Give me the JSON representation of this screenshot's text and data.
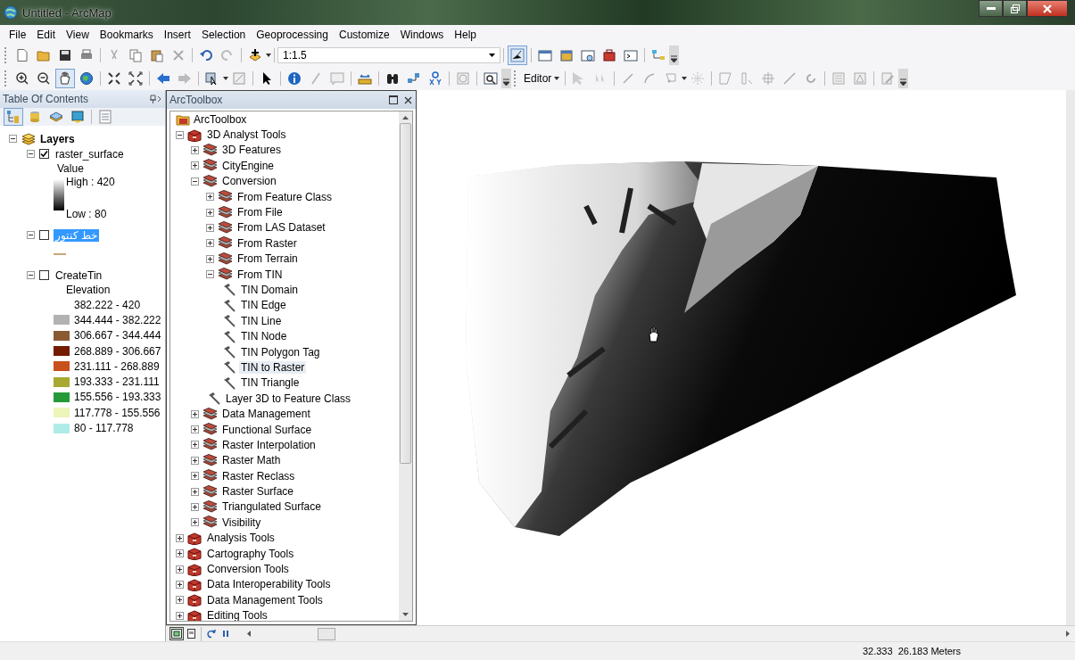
{
  "window": {
    "title": "Untitled - ArcMap"
  },
  "menu": [
    "File",
    "Edit",
    "View",
    "Bookmarks",
    "Insert",
    "Selection",
    "Geoprocessing",
    "Customize",
    "Windows",
    "Help"
  ],
  "standard_toolbar": {
    "scale": "1:1.5"
  },
  "tools_toolbar": {
    "editor_menu": "Editor"
  },
  "table_of_contents": {
    "title": "Table Of Contents",
    "root": {
      "label": "Layers",
      "expanded": true
    },
    "layers": [
      {
        "name": "raster_surface",
        "kind": "stretch",
        "expanded": true,
        "checked": true,
        "selected": false,
        "field": "Value",
        "high": "High : 420",
        "low": "Low : 80"
      },
      {
        "name": "خط کنتور",
        "kind": "line",
        "expanded": true,
        "checked": false,
        "selected": true
      },
      {
        "name": "CreateTin",
        "kind": "classes",
        "expanded": true,
        "checked": false,
        "selected": false,
        "field": "Elevation",
        "classes": [
          {
            "label": "382.222 - 420"
          },
          {
            "label": "344.444 - 382.222",
            "color": "#b2b2b2"
          },
          {
            "label": "306.667 - 344.444",
            "color": "#8a5a32"
          },
          {
            "label": "268.889 - 306.667",
            "color": "#731c00"
          },
          {
            "label": "231.111 - 268.889",
            "color": "#c8501a"
          },
          {
            "label": "193.333 - 231.111",
            "color": "#a8a832"
          },
          {
            "label": "155.556 - 193.333",
            "color": "#269a38"
          },
          {
            "label": "117.778 - 155.556",
            "color": "#eef5b8"
          },
          {
            "label": "80 - 117.778",
            "color": "#b0ece6"
          }
        ]
      }
    ]
  },
  "arctoolbox": {
    "title": "ArcToolbox",
    "root": "ArcToolbox",
    "items": [
      {
        "label": "3D Analyst Tools",
        "kind": "toolbox",
        "expanded": true,
        "children": [
          {
            "label": "3D Features",
            "kind": "toolset",
            "expanded": false
          },
          {
            "label": "CityEngine",
            "kind": "toolset",
            "expanded": false
          },
          {
            "label": "Conversion",
            "kind": "toolset",
            "expanded": true,
            "children": [
              {
                "label": "From Feature Class",
                "kind": "toolset",
                "expanded": false
              },
              {
                "label": "From File",
                "kind": "toolset",
                "expanded": false
              },
              {
                "label": "From LAS Dataset",
                "kind": "toolset",
                "expanded": false
              },
              {
                "label": "From Raster",
                "kind": "toolset",
                "expanded": false
              },
              {
                "label": "From Terrain",
                "kind": "toolset",
                "expanded": false
              },
              {
                "label": "From TIN",
                "kind": "toolset",
                "expanded": true,
                "children": [
                  {
                    "label": "TIN Domain",
                    "kind": "tool",
                    "selected": false
                  },
                  {
                    "label": "TIN Edge",
                    "kind": "tool",
                    "selected": false
                  },
                  {
                    "label": "TIN Line",
                    "kind": "tool",
                    "selected": false
                  },
                  {
                    "label": "TIN Node",
                    "kind": "tool",
                    "selected": false
                  },
                  {
                    "label": "TIN Polygon Tag",
                    "kind": "tool",
                    "selected": false
                  },
                  {
                    "label": "TIN to Raster",
                    "kind": "tool",
                    "selected": true
                  },
                  {
                    "label": "TIN Triangle",
                    "kind": "tool",
                    "selected": false
                  }
                ]
              },
              {
                "label": "Layer 3D to Feature Class",
                "kind": "tool",
                "selected": false
              }
            ]
          },
          {
            "label": "Data Management",
            "kind": "toolset",
            "expanded": false
          },
          {
            "label": "Functional Surface",
            "kind": "toolset",
            "expanded": false
          },
          {
            "label": "Raster Interpolation",
            "kind": "toolset",
            "expanded": false
          },
          {
            "label": "Raster Math",
            "kind": "toolset",
            "expanded": false
          },
          {
            "label": "Raster Reclass",
            "kind": "toolset",
            "expanded": false
          },
          {
            "label": "Raster Surface",
            "kind": "toolset",
            "expanded": false
          },
          {
            "label": "Triangulated Surface",
            "kind": "toolset",
            "expanded": false
          },
          {
            "label": "Visibility",
            "kind": "toolset",
            "expanded": false
          }
        ]
      },
      {
        "label": "Analysis Tools",
        "kind": "toolbox",
        "expanded": false
      },
      {
        "label": "Cartography Tools",
        "kind": "toolbox",
        "expanded": false
      },
      {
        "label": "Conversion Tools",
        "kind": "toolbox",
        "expanded": false
      },
      {
        "label": "Data Interoperability Tools",
        "kind": "toolbox",
        "expanded": false
      },
      {
        "label": "Data Management Tools",
        "kind": "toolbox",
        "expanded": false
      },
      {
        "label": "Editing Tools",
        "kind": "toolbox",
        "expanded": false
      }
    ]
  },
  "status_bar": {
    "coordinates": "32.333  26.183 Meters"
  }
}
